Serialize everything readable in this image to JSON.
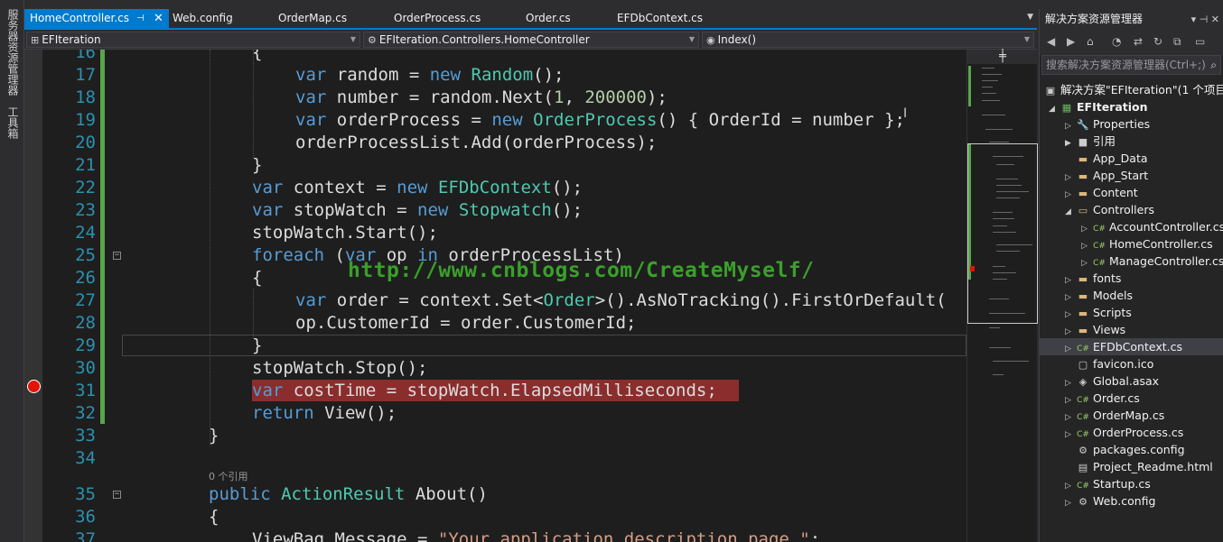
{
  "left_strip": {
    "server_explorer": "服务器资源管理器",
    "toolbox": "工具箱"
  },
  "tabs": [
    {
      "label": "HomeController.cs",
      "active": true
    },
    {
      "label": "Web.config"
    },
    {
      "label": "OrderMap.cs"
    },
    {
      "label": "OrderProcess.cs"
    },
    {
      "label": "Order.cs"
    },
    {
      "label": "EFDbContext.cs"
    }
  ],
  "navbar": {
    "project": "EFIteration",
    "class": "EFIteration.Controllers.HomeController",
    "member": "Index()"
  },
  "editor": {
    "line_numbers": [
      "16",
      "17",
      "18",
      "19",
      "20",
      "21",
      "22",
      "23",
      "24",
      "25",
      "26",
      "27",
      "28",
      "29",
      "30",
      "31",
      "32",
      "33",
      "34",
      "35",
      "36",
      "37"
    ],
    "codelens": "0 个引用",
    "watermark": "http://www.cnblogs.com/CreateMyself/",
    "breakpoint_line": "31"
  },
  "solution_explorer": {
    "title": "解决方案资源管理器",
    "search_placeholder": "搜索解决方案资源管理器(Ctrl+;)",
    "solution_label": "解决方案\"EFIteration\"(1 个项目)",
    "project": "EFIteration",
    "items": {
      "properties": "Properties",
      "references": "引用",
      "app_data": "App_Data",
      "app_start": "App_Start",
      "content": "Content",
      "controllers": "Controllers",
      "account_controller": "AccountController.cs",
      "home_controller": "HomeController.cs",
      "manage_controller": "ManageController.cs",
      "fonts": "fonts",
      "models": "Models",
      "scripts": "Scripts",
      "views": "Views",
      "efdbcontext": "EFDbContext.cs",
      "favicon": "favicon.ico",
      "global": "Global.asax",
      "order": "Order.cs",
      "ordermap": "OrderMap.cs",
      "orderprocess": "OrderProcess.cs",
      "packages": "packages.config",
      "readme": "Project_Readme.html",
      "startup": "Startup.cs",
      "webconfig": "Web.config"
    }
  },
  "colors": {
    "accent": "#007acc",
    "breakpoint": "#e51400",
    "change_bar": "#57a64a"
  }
}
